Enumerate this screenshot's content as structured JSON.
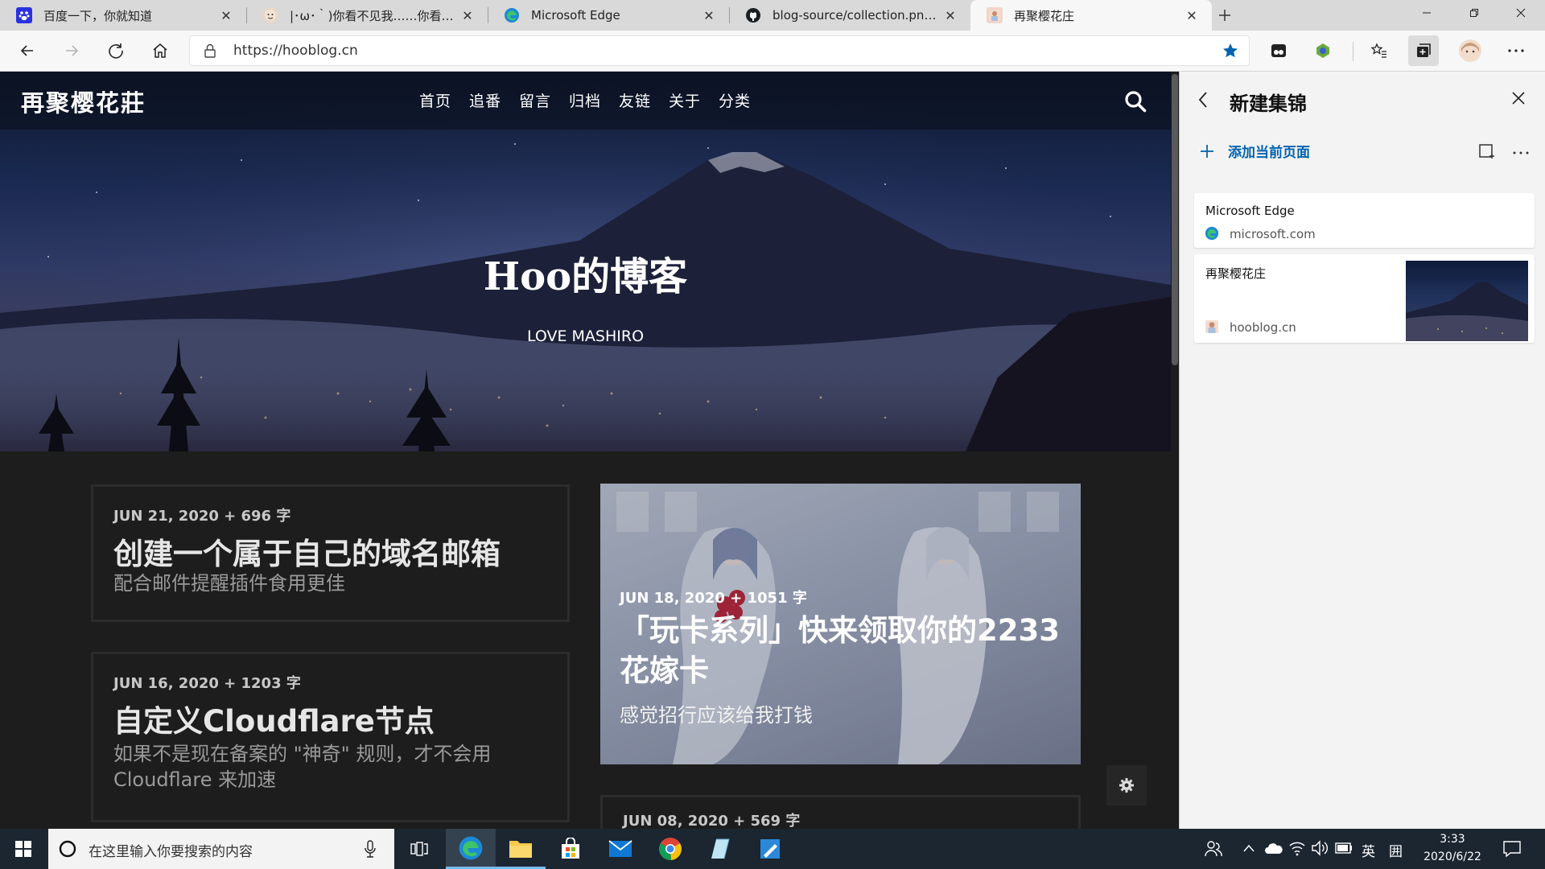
{
  "browser": {
    "tabs": [
      {
        "title": "百度一下，你就知道",
        "favicon": "baidu-icon"
      },
      {
        "title": "|･ω･｀)你看不见我……你看不见我",
        "favicon": "avatar-icon"
      },
      {
        "title": "Microsoft Edge",
        "favicon": "edge-icon"
      },
      {
        "title": "blog-source/collection.png at m",
        "favicon": "github-icon"
      },
      {
        "title": "再聚樱花庄",
        "favicon": "sakura-icon"
      }
    ],
    "address": "https://hooblog.cn",
    "accent": "#0063b1"
  },
  "site": {
    "logo": "再聚樱花莊",
    "nav": [
      "首页",
      "追番",
      "留言",
      "归档",
      "友链",
      "关于",
      "分类"
    ],
    "hero_title": "Hoo的博客",
    "hero_subtitle": "LOVE MASHIRO",
    "posts": [
      {
        "meta": "JUN 21, 2020 + 696 字",
        "title": "创建一个属于自己的域名邮箱",
        "desc": "配合邮件提醒插件食用更佳"
      },
      {
        "meta": "JUN 16, 2020 + 1203 字",
        "title": "自定义Cloudflare节点",
        "desc1": "如果不是现在备案的 \"神奇\" 规则，才不会用",
        "desc2": "Cloudflare 来加速"
      },
      {
        "meta": "JUN 18, 2020 + 1051 字",
        "title1": "「玩卡系列」快来领取你的2233",
        "title2": "花嫁卡",
        "desc": "感觉招行应该给我打钱"
      },
      {
        "meta": "JUN 08, 2020 + 569 字"
      }
    ]
  },
  "collections": {
    "title": "新建集锦",
    "add_label": "添加当前页面",
    "items": [
      {
        "title": "Microsoft Edge",
        "domain": "microsoft.com"
      },
      {
        "title": "再聚樱花庄",
        "domain": "hooblog.cn"
      }
    ]
  },
  "taskbar": {
    "search_placeholder": "在这里输入你要搜索的内容",
    "ime": "英",
    "ime2": "囲",
    "time": "3:33",
    "date": "2020/6/22"
  }
}
